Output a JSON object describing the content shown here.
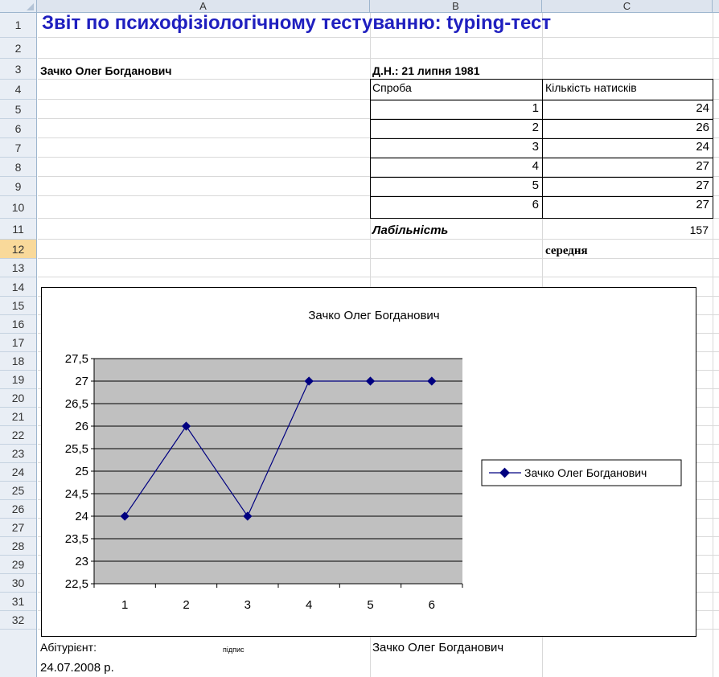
{
  "sheet": {
    "columns": [
      "A",
      "B",
      "C"
    ],
    "rows": [
      "1",
      "2",
      "3",
      "4",
      "5",
      "6",
      "7",
      "8",
      "9",
      "10",
      "11",
      "12",
      "13",
      "14",
      "15",
      "16",
      "17",
      "18",
      "19",
      "20",
      "21",
      "22",
      "23",
      "24",
      "25",
      "26",
      "27",
      "28",
      "29",
      "30",
      "31",
      "32"
    ],
    "selected_row": "12"
  },
  "cells": {
    "title": "Звіт по психофізіологічному тестуванню: typing-тест",
    "name": "Зачко Олег Богданович",
    "dob": "Д.Н.: 21 липня 1981",
    "attempt_header": "Спроба",
    "count_header": "Кількість натисків",
    "table_rows": [
      {
        "attempt": "1",
        "count": "24"
      },
      {
        "attempt": "2",
        "count": "26"
      },
      {
        "attempt": "3",
        "count": "24"
      },
      {
        "attempt": "4",
        "count": "27"
      },
      {
        "attempt": "5",
        "count": "27"
      },
      {
        "attempt": "6",
        "count": "27"
      }
    ],
    "lability_label": "Лабільність",
    "lability_value": "157",
    "lability_level": "середня",
    "applicant_label": "Абітурієнт:",
    "signature_label": "підпис",
    "applicant_name": "Зачко Олег Богданович",
    "date": "24.07.2008 р."
  },
  "chart_data": {
    "type": "line",
    "title": "Зачко Олег Богданович",
    "categories": [
      "1",
      "2",
      "3",
      "4",
      "5",
      "6"
    ],
    "series": [
      {
        "name": "Зачко Олег Богданович",
        "values": [
          24,
          26,
          24,
          27,
          27,
          27
        ]
      }
    ],
    "ylim": [
      22.5,
      27.5
    ],
    "y_ticks": [
      "27,5",
      "27",
      "26,5",
      "26",
      "25,5",
      "25",
      "24,5",
      "24",
      "23,5",
      "23",
      "22,5"
    ],
    "grid": true,
    "legend_position": "right",
    "colors": {
      "series": "#000080",
      "plot_bg": "#c0c0c0"
    }
  }
}
